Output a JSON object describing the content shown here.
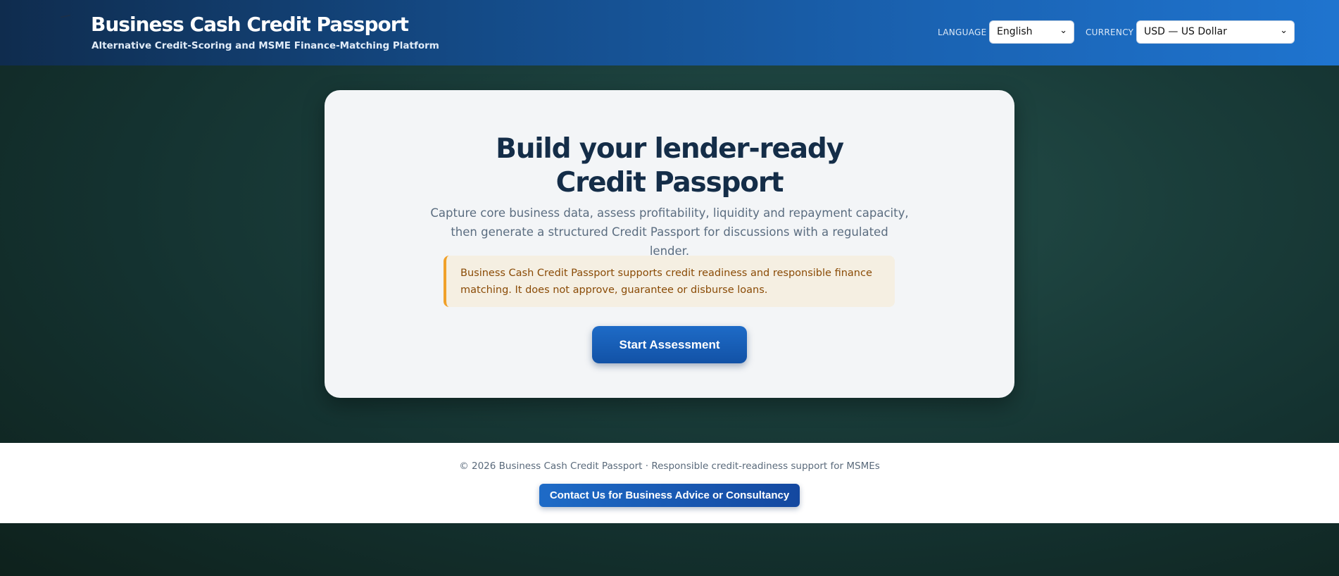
{
  "header": {
    "title": "Business Cash Credit Passport",
    "subtitle": "Alternative Credit-Scoring and MSME Finance-Matching Platform",
    "language_label": "LANGUAGE",
    "language_value": "English",
    "currency_label": "CURRENCY",
    "currency_value": "USD — US Dollar"
  },
  "hero": {
    "title": "Build your lender-ready Credit Passport",
    "description": "Capture core business data, assess profitability, liquidity and repayment capacity, then generate a structured Credit Passport for discussions with a regulated lender.",
    "notice": "Business Cash Credit Passport supports credit readiness and responsible finance matching. It does not approve, guarantee or disburse loans.",
    "start_button": "Start Assessment"
  },
  "footer": {
    "text": "© 2026 Business Cash Credit Passport · Responsible credit-readiness support for MSMEs",
    "contact_button": "Contact Us for Business Advice or Consultancy"
  },
  "icons": {
    "select_chevron": "chevron-down-icon"
  },
  "colors": {
    "brand_blue": "#1a63b3",
    "notice_accent": "#f0a12a",
    "title_navy": "#142d48"
  }
}
